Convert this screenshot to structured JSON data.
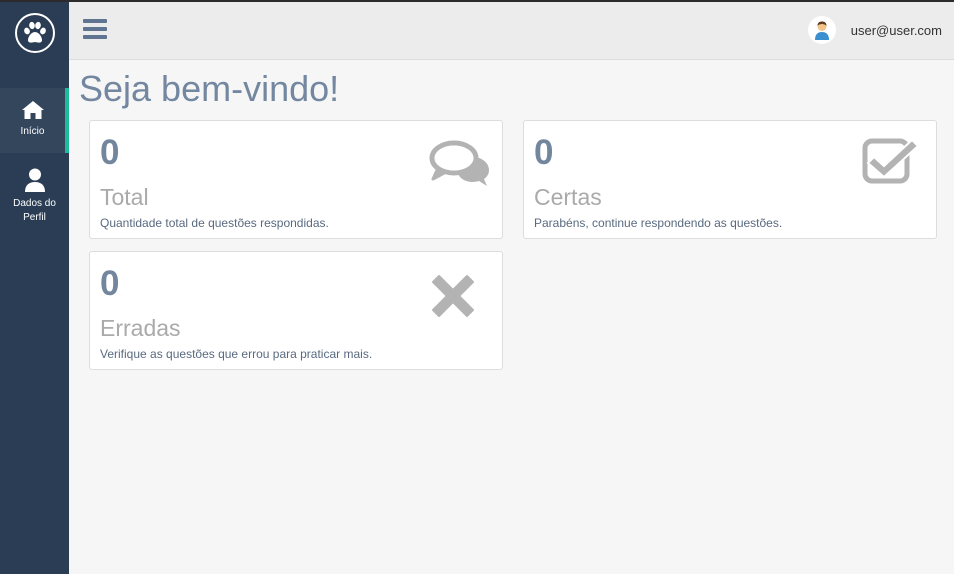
{
  "colors": {
    "sidebar_bg": "#2a3d54",
    "active_accent": "#1abc9c",
    "title": "#7387a0",
    "icon_gray": "#b3b3b3"
  },
  "sidebar": {
    "logo_icon": "paw-icon",
    "items": [
      {
        "label": "Início",
        "icon": "home-icon",
        "active": true
      },
      {
        "label": "Dados do Perfil",
        "icon": "user-icon",
        "active": false
      }
    ]
  },
  "header": {
    "menu_icon": "hamburger-icon",
    "user_email": "user@user.com"
  },
  "main": {
    "title": "Seja bem-vindo!",
    "cards": [
      {
        "count": "0",
        "label": "Total",
        "description": "Quantidade total de questões respondidas.",
        "icon": "comments-icon"
      },
      {
        "count": "0",
        "label": "Certas",
        "description": "Parabéns, continue respondendo as questões.",
        "icon": "check-square-icon"
      },
      {
        "count": "0",
        "label": "Erradas",
        "description": "Verifique as questões que errou para praticar mais.",
        "icon": "times-icon"
      }
    ]
  }
}
